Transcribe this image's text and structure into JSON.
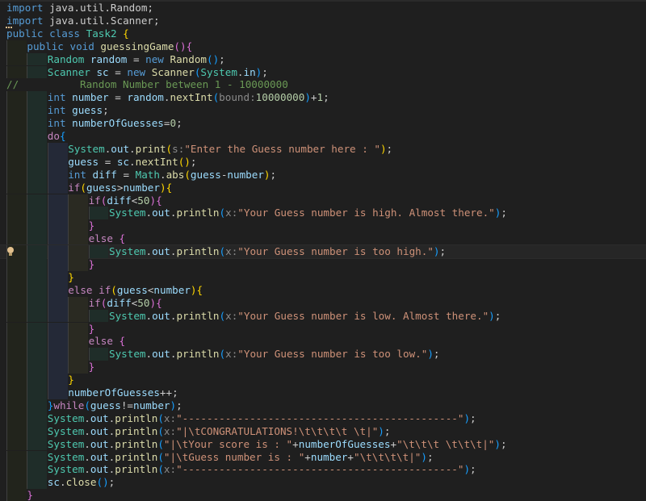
{
  "editor": {
    "language": "Java",
    "theme": "dark",
    "lightbulb_icon": "lightbulb-icon",
    "accent_colors": {
      "keyword": "#569cd6",
      "type": "#4ec9b0",
      "variable": "#9cdcfe",
      "function": "#dcdcaa",
      "string": "#ce9178",
      "number": "#b5cea8",
      "comment": "#6a9955"
    },
    "lines": [
      {
        "indent": 0,
        "tokens": [
          [
            "kw",
            "import"
          ],
          [
            "pl",
            " java.util.Random;"
          ]
        ]
      },
      {
        "indent": 0,
        "tokens": [
          [
            "kw",
            "import"
          ],
          [
            "pl",
            " java.util.Scanner;"
          ]
        ]
      },
      {
        "indent": 0,
        "tokens": [
          [
            "kw",
            "public"
          ],
          [
            "pl",
            " "
          ],
          [
            "kw",
            "class"
          ],
          [
            "pl",
            " "
          ],
          [
            "ty",
            "Task2"
          ],
          [
            "pl",
            " "
          ],
          [
            "b1",
            "{"
          ]
        ]
      },
      {
        "indent": 1,
        "tokens": [
          [
            "kw",
            "public"
          ],
          [
            "pl",
            " "
          ],
          [
            "kw",
            "void"
          ],
          [
            "pl",
            " "
          ],
          [
            "fn",
            "guessingGame"
          ],
          [
            "b2",
            "()"
          ],
          [
            "b2",
            "{"
          ]
        ]
      },
      {
        "indent": 2,
        "tokens": [
          [
            "ty",
            "Random"
          ],
          [
            "pl",
            " "
          ],
          [
            "var",
            "random"
          ],
          [
            "pl",
            " = "
          ],
          [
            "kw",
            "new"
          ],
          [
            "pl",
            " "
          ],
          [
            "fn",
            "Random"
          ],
          [
            "b3",
            "()"
          ],
          [
            "pl",
            ";"
          ]
        ]
      },
      {
        "indent": 2,
        "tokens": [
          [
            "ty",
            "Scanner"
          ],
          [
            "pl",
            " "
          ],
          [
            "var",
            "sc"
          ],
          [
            "pl",
            " = "
          ],
          [
            "kw",
            "new"
          ],
          [
            "pl",
            " "
          ],
          [
            "fn",
            "Scanner"
          ],
          [
            "b3",
            "("
          ],
          [
            "ty",
            "System"
          ],
          [
            "pl",
            "."
          ],
          [
            "var",
            "in"
          ],
          [
            "b3",
            ")"
          ],
          [
            "pl",
            ";"
          ]
        ]
      },
      {
        "indent": 0,
        "tokens": [
          [
            "cmt",
            "//          Random Number between 1 - 10000000"
          ]
        ]
      },
      {
        "indent": 2,
        "tokens": [
          [
            "kw",
            "int"
          ],
          [
            "pl",
            " "
          ],
          [
            "var",
            "number"
          ],
          [
            "pl",
            " = "
          ],
          [
            "var",
            "random"
          ],
          [
            "pl",
            "."
          ],
          [
            "fn",
            "nextInt"
          ],
          [
            "b3",
            "("
          ],
          [
            "hint",
            "bound:"
          ],
          [
            "num",
            "10000000"
          ],
          [
            "b3",
            ")"
          ],
          [
            "pl",
            "+"
          ],
          [
            "num",
            "1"
          ],
          [
            "pl",
            ";"
          ]
        ]
      },
      {
        "indent": 2,
        "tokens": [
          [
            "kw",
            "int"
          ],
          [
            "pl",
            " "
          ],
          [
            "var",
            "guess"
          ],
          [
            "pl",
            ";"
          ]
        ]
      },
      {
        "indent": 2,
        "tokens": [
          [
            "kw",
            "int"
          ],
          [
            "pl",
            " "
          ],
          [
            "var",
            "numberOfGuesses"
          ],
          [
            "pl",
            "="
          ],
          [
            "num",
            "0"
          ],
          [
            "pl",
            ";"
          ]
        ]
      },
      {
        "indent": 2,
        "tokens": [
          [
            "ctl",
            "do"
          ],
          [
            "b3",
            "{"
          ]
        ]
      },
      {
        "indent": 3,
        "tokens": [
          [
            "ty",
            "System"
          ],
          [
            "pl",
            "."
          ],
          [
            "var",
            "out"
          ],
          [
            "pl",
            "."
          ],
          [
            "fn",
            "print"
          ],
          [
            "b1",
            "("
          ],
          [
            "hint",
            "s:"
          ],
          [
            "str",
            "\"Enter the Guess number here : \""
          ],
          [
            "b1",
            ")"
          ],
          [
            "pl",
            ";"
          ]
        ]
      },
      {
        "indent": 3,
        "tokens": [
          [
            "var",
            "guess"
          ],
          [
            "pl",
            " = "
          ],
          [
            "var",
            "sc"
          ],
          [
            "pl",
            "."
          ],
          [
            "fn",
            "nextInt"
          ],
          [
            "b1",
            "()"
          ],
          [
            "pl",
            ";"
          ]
        ]
      },
      {
        "indent": 3,
        "tokens": [
          [
            "kw",
            "int"
          ],
          [
            "pl",
            " "
          ],
          [
            "var",
            "diff"
          ],
          [
            "pl",
            " = "
          ],
          [
            "ty",
            "Math"
          ],
          [
            "pl",
            "."
          ],
          [
            "fn",
            "abs"
          ],
          [
            "b1",
            "("
          ],
          [
            "var",
            "guess"
          ],
          [
            "pl",
            "-"
          ],
          [
            "var",
            "number"
          ],
          [
            "b1",
            ")"
          ],
          [
            "pl",
            ";"
          ]
        ]
      },
      {
        "indent": 3,
        "tokens": [
          [
            "ctl",
            "if"
          ],
          [
            "b1",
            "("
          ],
          [
            "var",
            "guess"
          ],
          [
            "pl",
            ">"
          ],
          [
            "var",
            "number"
          ],
          [
            "b1",
            ")"
          ],
          [
            "b1",
            "{"
          ]
        ]
      },
      {
        "indent": 4,
        "tokens": [
          [
            "ctl",
            "if"
          ],
          [
            "b2",
            "("
          ],
          [
            "var",
            "diff"
          ],
          [
            "pl",
            "<"
          ],
          [
            "num",
            "50"
          ],
          [
            "b2",
            ")"
          ],
          [
            "b2",
            "{"
          ]
        ]
      },
      {
        "indent": 5,
        "tokens": [
          [
            "ty",
            "System"
          ],
          [
            "pl",
            "."
          ],
          [
            "var",
            "out"
          ],
          [
            "pl",
            "."
          ],
          [
            "fn",
            "println"
          ],
          [
            "b3",
            "("
          ],
          [
            "hint",
            "x:"
          ],
          [
            "str",
            "\"Your Guess number is high. Almost there.\""
          ],
          [
            "b3",
            ")"
          ],
          [
            "pl",
            ";"
          ]
        ]
      },
      {
        "indent": 4,
        "tokens": [
          [
            "b2",
            "}"
          ]
        ]
      },
      {
        "indent": 4,
        "tokens": [
          [
            "ctl",
            "else"
          ],
          [
            "pl",
            " "
          ],
          [
            "b2",
            "{"
          ]
        ]
      },
      {
        "indent": 5,
        "current": true,
        "bulb": true,
        "tokens": [
          [
            "ty",
            "System"
          ],
          [
            "pl",
            "."
          ],
          [
            "var",
            "out"
          ],
          [
            "pl",
            "."
          ],
          [
            "fn",
            "println"
          ],
          [
            "b3",
            "("
          ],
          [
            "hint",
            "x:"
          ],
          [
            "str",
            "\"Your Guess number is too high.\""
          ],
          [
            "b3",
            ")"
          ],
          [
            "pl",
            ";"
          ]
        ]
      },
      {
        "indent": 4,
        "tokens": [
          [
            "b2",
            "}"
          ]
        ]
      },
      {
        "indent": 3,
        "tokens": [
          [
            "b1",
            "}"
          ]
        ]
      },
      {
        "indent": 3,
        "tokens": [
          [
            "ctl",
            "else"
          ],
          [
            "pl",
            " "
          ],
          [
            "ctl",
            "if"
          ],
          [
            "b1",
            "("
          ],
          [
            "var",
            "guess"
          ],
          [
            "pl",
            "<"
          ],
          [
            "var",
            "number"
          ],
          [
            "b1",
            ")"
          ],
          [
            "b1",
            "{"
          ]
        ]
      },
      {
        "indent": 4,
        "tokens": [
          [
            "ctl",
            "if"
          ],
          [
            "b2",
            "("
          ],
          [
            "var",
            "diff"
          ],
          [
            "pl",
            "<"
          ],
          [
            "num",
            "50"
          ],
          [
            "b2",
            ")"
          ],
          [
            "b2",
            "{"
          ]
        ]
      },
      {
        "indent": 5,
        "tokens": [
          [
            "ty",
            "System"
          ],
          [
            "pl",
            "."
          ],
          [
            "var",
            "out"
          ],
          [
            "pl",
            "."
          ],
          [
            "fn",
            "println"
          ],
          [
            "b3",
            "("
          ],
          [
            "hint",
            "x:"
          ],
          [
            "str",
            "\"Your Guess number is low. Almost there.\""
          ],
          [
            "b3",
            ")"
          ],
          [
            "pl",
            ";"
          ]
        ]
      },
      {
        "indent": 4,
        "tokens": [
          [
            "b2",
            "}"
          ]
        ]
      },
      {
        "indent": 4,
        "tokens": [
          [
            "ctl",
            "else"
          ],
          [
            "pl",
            " "
          ],
          [
            "b2",
            "{"
          ]
        ]
      },
      {
        "indent": 5,
        "tokens": [
          [
            "ty",
            "System"
          ],
          [
            "pl",
            "."
          ],
          [
            "var",
            "out"
          ],
          [
            "pl",
            "."
          ],
          [
            "fn",
            "println"
          ],
          [
            "b3",
            "("
          ],
          [
            "hint",
            "x:"
          ],
          [
            "str",
            "\"Your Guess number is too low.\""
          ],
          [
            "b3",
            ")"
          ],
          [
            "pl",
            ";"
          ]
        ]
      },
      {
        "indent": 4,
        "tokens": [
          [
            "b2",
            "}"
          ]
        ]
      },
      {
        "indent": 3,
        "tokens": [
          [
            "b1",
            "}"
          ]
        ]
      },
      {
        "indent": 3,
        "tokens": [
          [
            "var",
            "numberOfGuesses"
          ],
          [
            "pl",
            "++;"
          ]
        ]
      },
      {
        "indent": 2,
        "tokens": [
          [
            "b3",
            "}"
          ],
          [
            "ctl",
            "while"
          ],
          [
            "b3",
            "("
          ],
          [
            "var",
            "guess"
          ],
          [
            "pl",
            "!="
          ],
          [
            "var",
            "number"
          ],
          [
            "b3",
            ")"
          ],
          [
            "pl",
            ";"
          ]
        ]
      },
      {
        "indent": 2,
        "tokens": [
          [
            "ty",
            "System"
          ],
          [
            "pl",
            "."
          ],
          [
            "var",
            "out"
          ],
          [
            "pl",
            "."
          ],
          [
            "fn",
            "println"
          ],
          [
            "b3",
            "("
          ],
          [
            "hint",
            "x:"
          ],
          [
            "str",
            "\"---------------------------------------------\""
          ],
          [
            "b3",
            ")"
          ],
          [
            "pl",
            ";"
          ]
        ]
      },
      {
        "indent": 2,
        "tokens": [
          [
            "ty",
            "System"
          ],
          [
            "pl",
            "."
          ],
          [
            "var",
            "out"
          ],
          [
            "pl",
            "."
          ],
          [
            "fn",
            "println"
          ],
          [
            "b3",
            "("
          ],
          [
            "hint",
            "x:"
          ],
          [
            "str",
            "\"|\\tCONGRATULATIONS!\\t\\t\\t\\t \\t|\""
          ],
          [
            "b3",
            ")"
          ],
          [
            "pl",
            ";"
          ]
        ]
      },
      {
        "indent": 2,
        "tokens": [
          [
            "ty",
            "System"
          ],
          [
            "pl",
            "."
          ],
          [
            "var",
            "out"
          ],
          [
            "pl",
            "."
          ],
          [
            "fn",
            "println"
          ],
          [
            "b3",
            "("
          ],
          [
            "str",
            "\"|\\tYour score is : \""
          ],
          [
            "pl",
            "+"
          ],
          [
            "var",
            "numberOfGuesses"
          ],
          [
            "pl",
            "+"
          ],
          [
            "str",
            "\"\\t\\t\\t \\t\\t\\t|\""
          ],
          [
            "b3",
            ")"
          ],
          [
            "pl",
            ";"
          ]
        ]
      },
      {
        "indent": 2,
        "tokens": [
          [
            "ty",
            "System"
          ],
          [
            "pl",
            "."
          ],
          [
            "var",
            "out"
          ],
          [
            "pl",
            "."
          ],
          [
            "fn",
            "println"
          ],
          [
            "b3",
            "("
          ],
          [
            "str",
            "\"|\\tGuess number is : \""
          ],
          [
            "pl",
            "+"
          ],
          [
            "var",
            "number"
          ],
          [
            "pl",
            "+"
          ],
          [
            "str",
            "\"\\t\\t\\t\\t|\""
          ],
          [
            "b3",
            ")"
          ],
          [
            "pl",
            ";"
          ]
        ]
      },
      {
        "indent": 2,
        "tokens": [
          [
            "ty",
            "System"
          ],
          [
            "pl",
            "."
          ],
          [
            "var",
            "out"
          ],
          [
            "pl",
            "."
          ],
          [
            "fn",
            "println"
          ],
          [
            "b3",
            "("
          ],
          [
            "hint",
            "x:"
          ],
          [
            "str",
            "\"---------------------------------------------\""
          ],
          [
            "b3",
            ")"
          ],
          [
            "pl",
            ";"
          ]
        ]
      },
      {
        "indent": 2,
        "tokens": [
          [
            "var",
            "sc"
          ],
          [
            "pl",
            "."
          ],
          [
            "fn",
            "close"
          ],
          [
            "b3",
            "()"
          ],
          [
            "pl",
            ";"
          ]
        ]
      },
      {
        "indent": 1,
        "tokens": [
          [
            "b2",
            "}"
          ]
        ]
      }
    ]
  }
}
